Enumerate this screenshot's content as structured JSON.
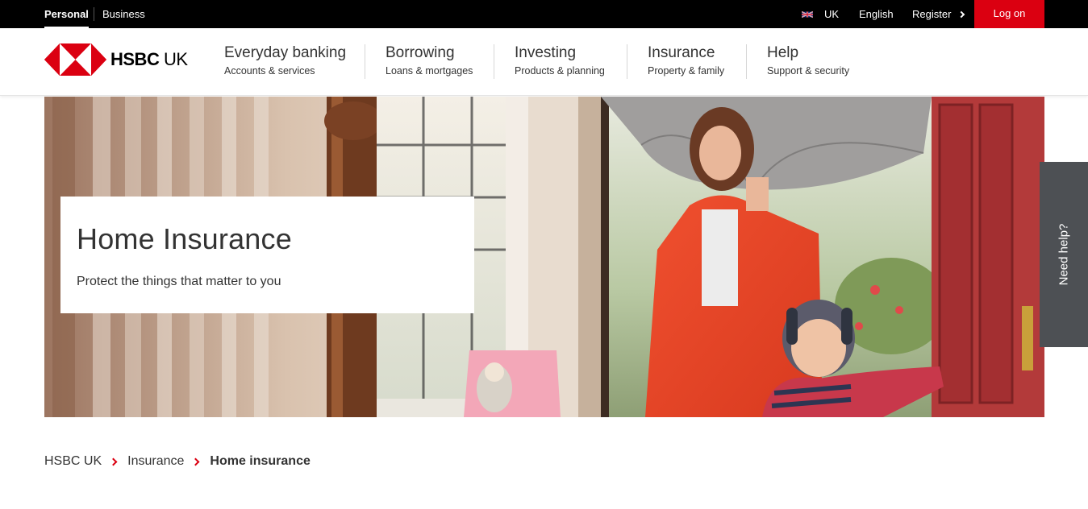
{
  "topbar": {
    "segments": [
      "Personal",
      "Business"
    ],
    "country": "UK",
    "language": "English",
    "register": "Register",
    "logon": "Log on"
  },
  "brand": {
    "name_bold": "HSBC",
    "name_light": " UK",
    "accent_color": "#db0011"
  },
  "nav": [
    {
      "title": "Everyday banking",
      "subtitle": "Accounts & services"
    },
    {
      "title": "Borrowing",
      "subtitle": "Loans & mortgages"
    },
    {
      "title": "Investing",
      "subtitle": "Products & planning"
    },
    {
      "title": "Insurance",
      "subtitle": "Property & family"
    },
    {
      "title": "Help",
      "subtitle": "Support & security"
    }
  ],
  "hero": {
    "title": "Home Insurance",
    "subtitle": "Protect the things that matter to you"
  },
  "side_tab": {
    "label": "Need help?"
  },
  "breadcrumb": [
    "HSBC UK",
    "Insurance",
    "Home insurance"
  ],
  "icons": {
    "flag": "uk-flag-icon",
    "register_chevron": "chevron-right-icon",
    "breadcrumb_separator": "chevron-right-icon"
  }
}
